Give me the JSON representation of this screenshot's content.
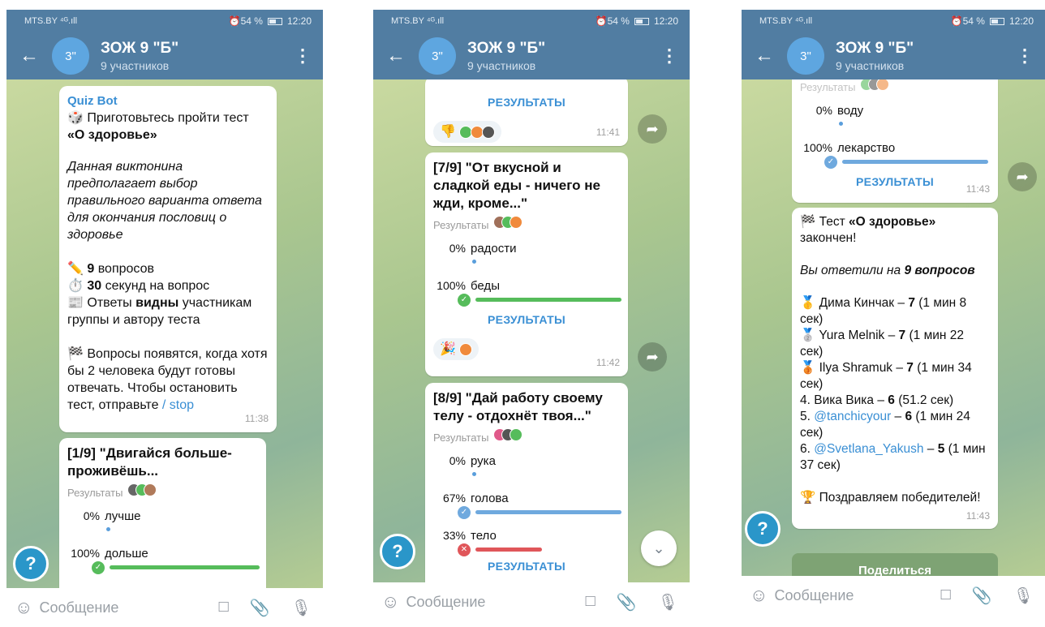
{
  "status": {
    "carrier": "MTS.BY",
    "signal": "⁴ᴳ.ıll",
    "right": "⏰54 %",
    "clock": "12:20"
  },
  "header": {
    "avatar": "3\"",
    "title": "ЗОЖ 9 \"Б\"",
    "subtitle": "9 участников"
  },
  "input": {
    "placeholder": "Сообщение"
  },
  "colors": {
    "header": "#517da2",
    "accent": "#3a8fd4",
    "correct": "#56bc5b",
    "wrong": "#e0565a",
    "voted": "#6fa9de"
  },
  "screen1": {
    "intro": {
      "sender": "Quiz Bot",
      "line1": "🎲 Приготовьтесь пройти тест",
      "test_name": "«О здоровье»",
      "description": "Данная виктонина предполагает выбор правильного варианта ответа для окончания пословиц о здоровье",
      "q_count": "9",
      "q_label": " вопросов",
      "sec_count": "30",
      "sec_label": " секунд на вопрос",
      "answers_pre": "📰 Ответы ",
      "answers_bold": "видны",
      "answers_post": " участникам группы и автору теста",
      "start_text": "🏁 Вопросы появятся, когда хотя бы 2 человека будут готовы отвечать. Чтобы остановить тест, отправьте ",
      "stop_cmd": "/ stop",
      "time": "11:38"
    },
    "q1": {
      "title": "[1/9] \"Двигайся больше-проживёшь...",
      "results_label": "Результаты",
      "options": [
        {
          "pct": "0%",
          "text": "лучше"
        },
        {
          "pct": "100%",
          "text": "дольше"
        }
      ]
    }
  },
  "screen2": {
    "top": {
      "results_btn": "РЕЗУЛЬТАТЫ",
      "time": "11:41"
    },
    "q7": {
      "title": "[7/9] \"От вкусной и сладкой еды - ничего не жди, кроме...\"",
      "results_label": "Результаты",
      "options": [
        {
          "pct": "0%",
          "text": "радости"
        },
        {
          "pct": "100%",
          "text": "беды"
        }
      ],
      "results_btn": "РЕЗУЛЬТАТЫ",
      "time": "11:42"
    },
    "q8": {
      "title": "[8/9] \"Дай работу своему телу - отдохнёт твоя...\"",
      "results_label": "Результаты",
      "options": [
        {
          "pct": "0%",
          "text": "рука"
        },
        {
          "pct": "67%",
          "text": "голова"
        },
        {
          "pct": "33%",
          "text": "тело"
        }
      ],
      "results_btn": "РЕЗУЛЬТАТЫ"
    }
  },
  "screen3": {
    "q9": {
      "results_label": "Результаты",
      "options": [
        {
          "pct": "0%",
          "text": "воду"
        },
        {
          "pct": "100%",
          "text": "лекарство"
        }
      ],
      "results_btn": "РЕЗУЛЬТАТЫ",
      "time": "11:43"
    },
    "final": {
      "line1_pre": "🏁 Тест ",
      "line1_bold": "«О здоровье»",
      "line1_post": " закончен!",
      "answered_pre": "Вы ответили на ",
      "answered_bold": "9 вопросов",
      "rows": [
        {
          "prefix": "🥇 ",
          "name": "Дима Кинчак",
          "score": "7",
          "rest": " (1 мин 8 сек)"
        },
        {
          "prefix": "🥈 ",
          "name": "Yura Melnik",
          "score": "7",
          "rest": " (1 мин 22 сек)"
        },
        {
          "prefix": "🥉 ",
          "name": "Ilya Shramuk",
          "score": "7",
          "rest": " (1 мин 34 сек)"
        },
        {
          "prefix": "   4. ",
          "name": "Вика Вика",
          "score": "6",
          "rest": " (51.2 сек)"
        },
        {
          "prefix": "   5. ",
          "name": "@tanchicyour",
          "score": "6",
          "rest": " (1 мин 24 сек)"
        },
        {
          "prefix": "   6. ",
          "name": "@Svetlana_Yakush",
          "score": "5",
          "rest": " (1 мин 37 сек)"
        }
      ],
      "congrats": "🏆 Поздравляем победителей!",
      "time": "11:43"
    },
    "share_label": "Поделиться"
  }
}
